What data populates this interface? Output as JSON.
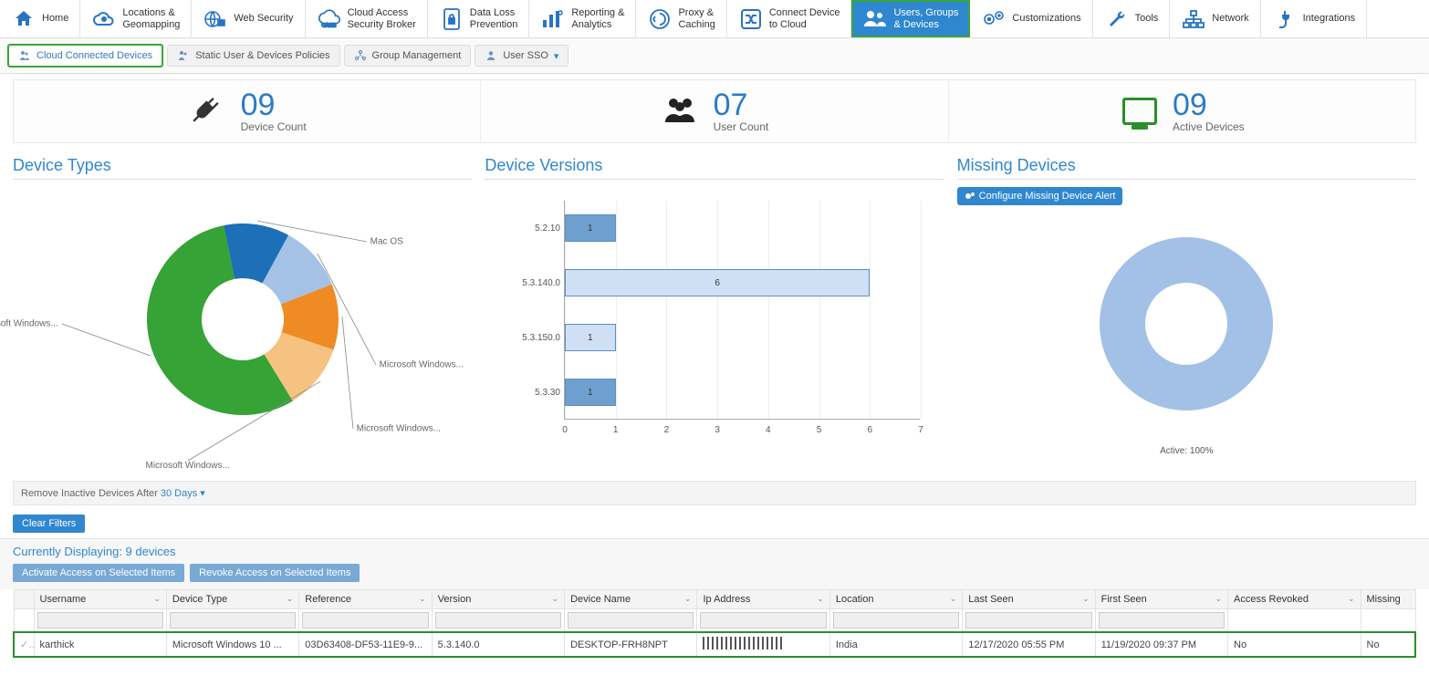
{
  "main_nav": [
    {
      "icon": "home",
      "label": "Home"
    },
    {
      "icon": "cloud",
      "label": "Locations &\nGeomapping"
    },
    {
      "icon": "globe",
      "label": "Web Security"
    },
    {
      "icon": "casb",
      "label": "Cloud Access\nSecurity Broker"
    },
    {
      "icon": "lock-doc",
      "label": "Data Loss\nPrevention"
    },
    {
      "icon": "bar",
      "label": "Reporting &\nAnalytics"
    },
    {
      "icon": "ring",
      "label": "Proxy &\nCaching"
    },
    {
      "icon": "shuffle",
      "label": "Connect Device\nto Cloud"
    },
    {
      "icon": "users",
      "label": "Users, Groups\n& Devices",
      "active": true,
      "hl": true
    },
    {
      "icon": "gears",
      "label": "Customizations"
    },
    {
      "icon": "wrench",
      "label": "Tools"
    },
    {
      "icon": "net",
      "label": "Network"
    },
    {
      "icon": "plug",
      "label": "Integrations"
    }
  ],
  "sub_nav": [
    {
      "label": "Cloud Connected Devices",
      "active": true
    },
    {
      "label": "Static User & Devices Policies"
    },
    {
      "label": "Group Management"
    },
    {
      "label": "User SSO",
      "dropdown": true
    }
  ],
  "counters": {
    "device_count": {
      "num": "09",
      "label": "Device Count"
    },
    "user_count": {
      "num": "07",
      "label": "User Count"
    },
    "active_devices": {
      "num": "09",
      "label": "Active Devices"
    }
  },
  "panels": {
    "device_types": {
      "title": "Device Types"
    },
    "device_versions": {
      "title": "Device Versions"
    },
    "missing_devices": {
      "title": "Missing Devices",
      "button": "Configure Missing Device Alert",
      "caption": "Active: 100%"
    }
  },
  "chart_data": {
    "device_types": {
      "type": "pie",
      "title": "Device Types",
      "slices": [
        {
          "label": "Mac OS",
          "value": 1,
          "color": "#1d6fb8"
        },
        {
          "label": "Microsoft Windows...",
          "value": 1,
          "color": "#a4c2e6"
        },
        {
          "label": "Microsoft Windows...",
          "value": 1,
          "color": "#ee8b23"
        },
        {
          "label": "Microsoft Windows...",
          "value": 1,
          "color": "#f6c281"
        },
        {
          "label": "Microsoft Windows...",
          "value": 5,
          "color": "#35a335"
        }
      ]
    },
    "device_versions": {
      "type": "bar",
      "orientation": "horizontal",
      "categories": [
        "5.2.10",
        "5.3.140.0",
        "5.3.150.0",
        "5.3.30"
      ],
      "values": [
        1,
        6,
        1,
        1
      ],
      "colors": [
        "#6f9fcf",
        "#cfe0f4",
        "#cfe0f4",
        "#6f9fcf"
      ],
      "xlim": [
        0,
        7
      ],
      "xticks": [
        0,
        1,
        2,
        3,
        4,
        5,
        6,
        7
      ]
    },
    "missing_devices": {
      "type": "pie",
      "title": "Missing Devices",
      "slices": [
        {
          "label": "Active",
          "value": 100,
          "color": "#a3c1e6"
        }
      ]
    }
  },
  "inactive": {
    "prefix": "Remove Inactive Devices After ",
    "link": "30 Days"
  },
  "clear_filters": "Clear Filters",
  "displaying": "Currently Displaying: 9 devices",
  "actions": {
    "activate": "Activate Access on Selected Items",
    "revoke": "Revoke Access on Selected Items"
  },
  "table": {
    "headers": [
      "Username",
      "Device Type",
      "Reference",
      "Version",
      "Device Name",
      "Ip Address",
      "Location",
      "Last Seen",
      "First Seen",
      "Access Revoked",
      "Missing"
    ],
    "row": {
      "username": "karthick",
      "device_type": "Microsoft Windows 10 ...",
      "reference": "03D63408-DF53-11E9-9...",
      "version": "5.3.140.0",
      "device_name": "DESKTOP-FRH8NPT",
      "ip": "",
      "location": "India",
      "last_seen": "12/17/2020 05:55 PM",
      "first_seen": "11/19/2020 09:37 PM",
      "access_revoked": "No",
      "missing": "No"
    }
  }
}
